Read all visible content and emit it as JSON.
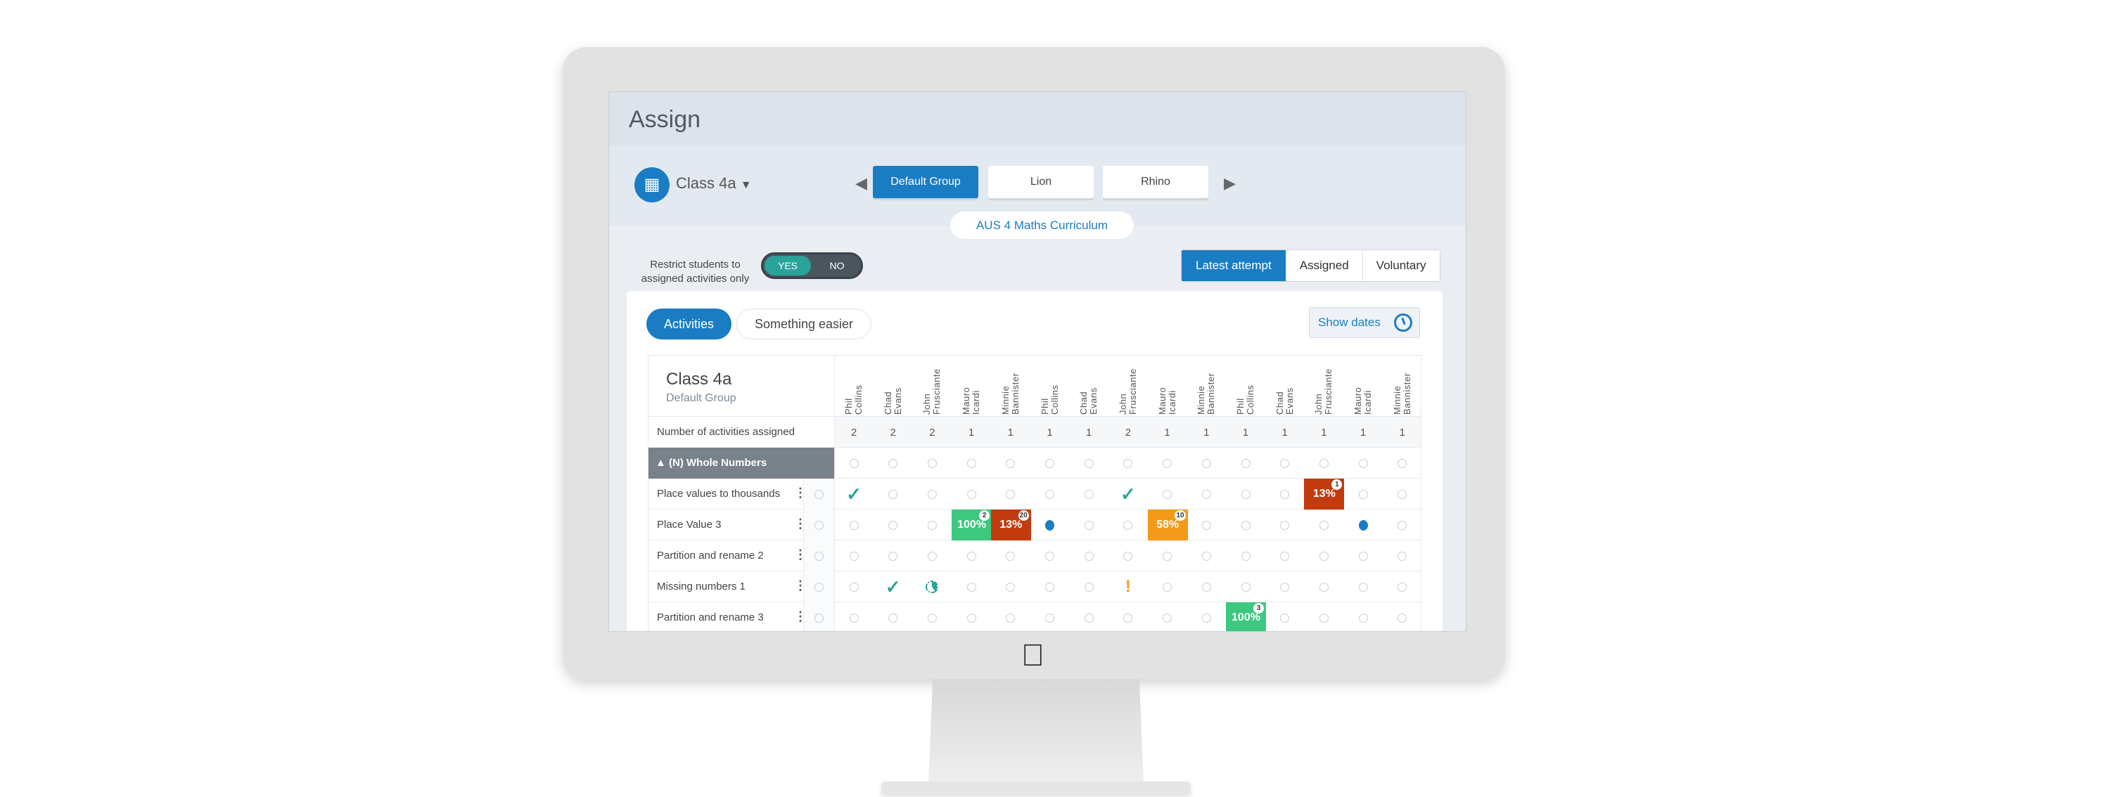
{
  "header": {
    "title": "Assign"
  },
  "class_selector": {
    "icon": "class-group-icon",
    "label": "Class 4a",
    "dropdown_icon": "caret-down-icon"
  },
  "group_tabs": [
    {
      "label": "Default Group",
      "active": true
    },
    {
      "label": "Lion",
      "active": false
    },
    {
      "label": "Rhino",
      "active": false
    }
  ],
  "curriculum": {
    "label": "AUS 4 Maths Curriculum"
  },
  "restrict": {
    "label": "Restrict students to assigned activities only",
    "yes": "YES",
    "no": "NO",
    "value": "YES"
  },
  "view_tabs": [
    {
      "label": "Latest attempt",
      "active": true
    },
    {
      "label": "Assigned",
      "active": false
    },
    {
      "label": "Voluntary",
      "active": false
    }
  ],
  "content_tabs": [
    {
      "label": "Activities",
      "active": true
    },
    {
      "label": "Something easier",
      "active": false
    }
  ],
  "show_dates": {
    "label": "Show dates",
    "icon": "clock-icon"
  },
  "colors": {
    "accent": "#1a7dc4",
    "teal": "#2aa39a",
    "green": "#3cc87f",
    "red": "#c23b0f",
    "orange": "#f49a1a",
    "group_header": "#79818a"
  },
  "table": {
    "class_name": "Class 4a",
    "group_name": "Default Group",
    "students": [
      [
        "Phil",
        "Collins"
      ],
      [
        "Chad",
        "Evans"
      ],
      [
        "John",
        "Frusciante"
      ],
      [
        "Mauro",
        "Icardi"
      ],
      [
        "Minnie",
        "Bannister"
      ],
      [
        "Phil",
        "Collins"
      ],
      [
        "Chad",
        "Evans"
      ],
      [
        "John",
        "Frusciante"
      ],
      [
        "Mauro",
        "Icardi"
      ],
      [
        "Minnie",
        "Bannister"
      ],
      [
        "Phil",
        "Collins"
      ],
      [
        "Chad",
        "Evans"
      ],
      [
        "John",
        "Frusciante"
      ],
      [
        "Mauro",
        "Icardi"
      ],
      [
        "Minnie",
        "Bannister"
      ]
    ],
    "count_label": "Number of activities assigned",
    "counts": [
      "2",
      "2",
      "2",
      "1",
      "1",
      "1",
      "1",
      "2",
      "1",
      "1",
      "1",
      "1",
      "1",
      "1",
      "1"
    ],
    "group": {
      "label": "(N) Whole Numbers",
      "icon": "triangle-up-icon"
    },
    "rows": [
      {
        "label": "Place values to thousands",
        "cells": {
          "1": {
            "type": "check"
          },
          "8": {
            "type": "check"
          },
          "13": {
            "type": "score",
            "value": "13%",
            "attempts": "1",
            "color": "#c23b0f"
          }
        }
      },
      {
        "label": "Place Value 3",
        "cells": {
          "4": {
            "type": "score",
            "value": "100%",
            "attempts": "2",
            "color": "#3cc87f"
          },
          "5": {
            "type": "score",
            "value": "13%",
            "attempts": "20",
            "color": "#c23b0f"
          },
          "6": {
            "type": "dot"
          },
          "9": {
            "type": "score",
            "value": "58%",
            "attempts": "10",
            "color": "#f49a1a"
          },
          "14": {
            "type": "dot"
          }
        }
      },
      {
        "label": "Partition and rename 2",
        "cells": {}
      },
      {
        "label": "Missing numbers 1",
        "cells": {
          "2": {
            "type": "check"
          },
          "3": {
            "type": "in-progress"
          },
          "8": {
            "type": "alert"
          }
        }
      },
      {
        "label": "Partition and rename 3",
        "cells": {
          "11": {
            "type": "score",
            "value": "100%",
            "attempts": "3",
            "color": "#3cc87f"
          }
        }
      }
    ]
  }
}
